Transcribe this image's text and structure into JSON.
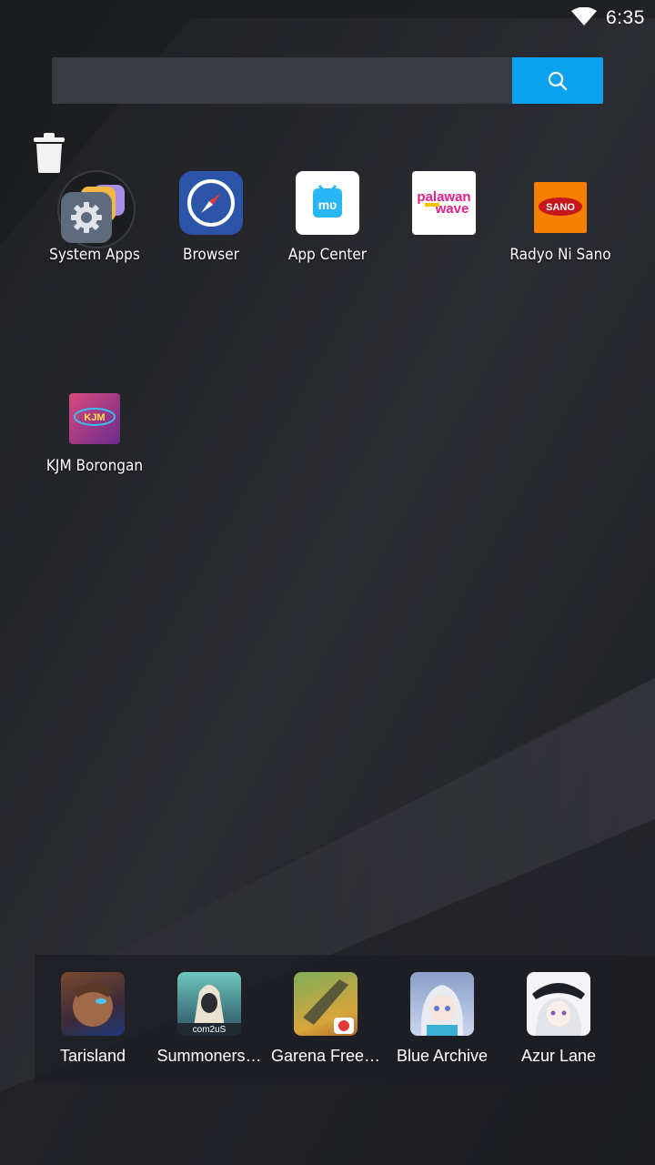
{
  "status_bar": {
    "time": "6:35",
    "wifi_icon": "wifi-icon"
  },
  "search": {
    "placeholder": "",
    "button_icon": "search-icon"
  },
  "trash_icon": "trash-icon",
  "desktop_apps": [
    {
      "label": "System Apps",
      "icon": "system-apps-folder-icon"
    },
    {
      "label": "Browser",
      "icon": "browser-compass-icon"
    },
    {
      "label": "App Center",
      "icon": "app-center-icon"
    },
    {
      "label": "",
      "icon": "palawan-wave-icon",
      "icon_text_1": "palawan",
      "icon_text_2": "wave"
    },
    {
      "label": "Radyo Ni Sano",
      "icon": "radyo-ni-sano-icon",
      "icon_text": "SANO"
    },
    {
      "label": "KJM Borongan",
      "icon": "kjm-borongan-icon",
      "icon_text": "KJM"
    }
  ],
  "dock": [
    {
      "label": "Tarisland",
      "icon": "tarisland-icon"
    },
    {
      "label": "Summoners…",
      "icon": "summoners-war-icon",
      "icon_text": "com2uS"
    },
    {
      "label": "Garena Free…",
      "icon": "garena-free-fire-icon"
    },
    {
      "label": "Blue Archive",
      "icon": "blue-archive-icon"
    },
    {
      "label": "Azur Lane",
      "icon": "azur-lane-icon"
    }
  ],
  "colors": {
    "accent": "#0aa2ee",
    "background": "#26272c"
  }
}
